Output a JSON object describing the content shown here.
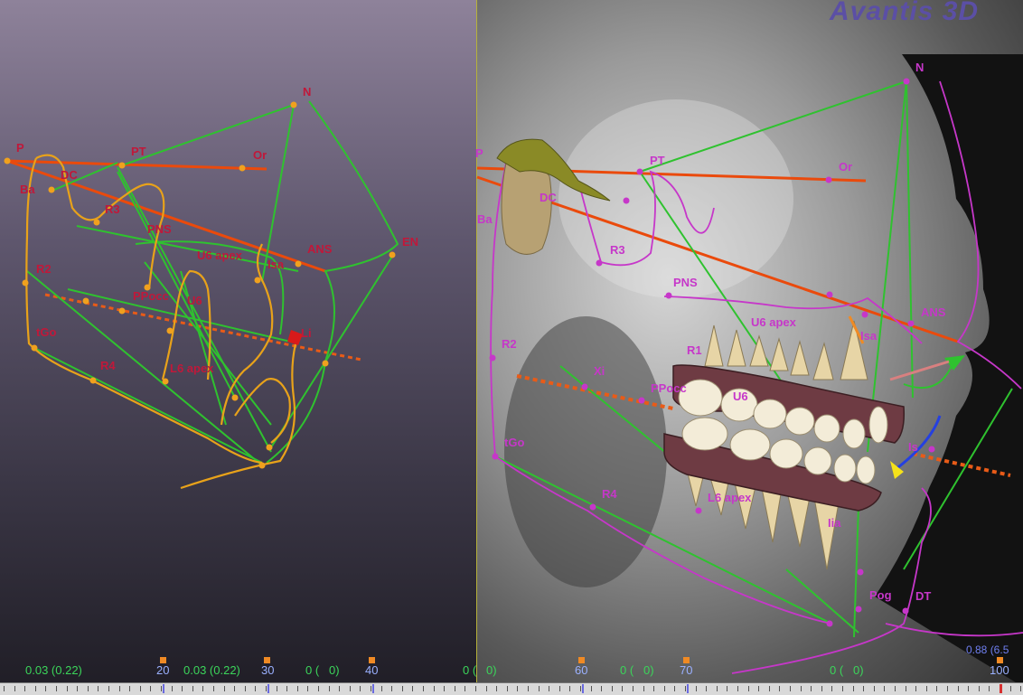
{
  "brand": {
    "name": "Avantis 3D"
  },
  "left_view": {
    "landmarks": [
      "N",
      "P",
      "PT",
      "Or",
      "DC",
      "Ba",
      "R3",
      "PNS",
      "U6 apex",
      "Isa",
      "ANS",
      "EN",
      "R2",
      "PPocc",
      "U6",
      "tGo",
      "R4",
      "L6 apex",
      "Li"
    ]
  },
  "right_view": {
    "landmarks": [
      "N",
      "P",
      "PT",
      "Or",
      "DC",
      "Ba",
      "R3",
      "PNS",
      "U6 apex",
      "Isa",
      "ANS",
      "R1",
      "R2",
      "Xi",
      "PPocc",
      "U6",
      "tGo",
      "Is",
      "R4",
      "L6 apex",
      "Iia",
      "Pog",
      "DT"
    ]
  },
  "ruler": {
    "readouts": [
      "0.03 (0.22)",
      "0.03 (0.22)",
      "0 (   0)",
      "0 (   0)",
      "0 (   0)",
      "0 (   0)"
    ],
    "ticks": [
      "20",
      "30",
      "40",
      "60",
      "70",
      "100"
    ],
    "top_value": "0.88 (6.5"
  },
  "colors": {
    "tracing_green": "#2fc22f",
    "reference_orange": "#ea4a0c",
    "contour_orange": "#e8a21a",
    "label_red": "#c0183a",
    "label_magenta": "#c637c9",
    "brand_purple": "#5b4fa5"
  }
}
